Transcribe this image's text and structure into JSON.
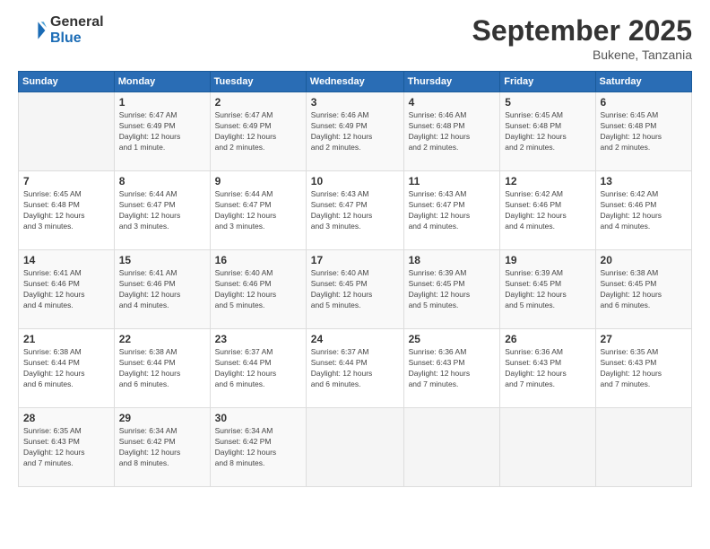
{
  "header": {
    "logo_general": "General",
    "logo_blue": "Blue",
    "title": "September 2025",
    "location": "Bukene, Tanzania"
  },
  "days_of_week": [
    "Sunday",
    "Monday",
    "Tuesday",
    "Wednesday",
    "Thursday",
    "Friday",
    "Saturday"
  ],
  "weeks": [
    [
      {
        "day": "",
        "info": ""
      },
      {
        "day": "1",
        "info": "Sunrise: 6:47 AM\nSunset: 6:49 PM\nDaylight: 12 hours\nand 1 minute."
      },
      {
        "day": "2",
        "info": "Sunrise: 6:47 AM\nSunset: 6:49 PM\nDaylight: 12 hours\nand 2 minutes."
      },
      {
        "day": "3",
        "info": "Sunrise: 6:46 AM\nSunset: 6:49 PM\nDaylight: 12 hours\nand 2 minutes."
      },
      {
        "day": "4",
        "info": "Sunrise: 6:46 AM\nSunset: 6:48 PM\nDaylight: 12 hours\nand 2 minutes."
      },
      {
        "day": "5",
        "info": "Sunrise: 6:45 AM\nSunset: 6:48 PM\nDaylight: 12 hours\nand 2 minutes."
      },
      {
        "day": "6",
        "info": "Sunrise: 6:45 AM\nSunset: 6:48 PM\nDaylight: 12 hours\nand 2 minutes."
      }
    ],
    [
      {
        "day": "7",
        "info": "Sunrise: 6:45 AM\nSunset: 6:48 PM\nDaylight: 12 hours\nand 3 minutes."
      },
      {
        "day": "8",
        "info": "Sunrise: 6:44 AM\nSunset: 6:47 PM\nDaylight: 12 hours\nand 3 minutes."
      },
      {
        "day": "9",
        "info": "Sunrise: 6:44 AM\nSunset: 6:47 PM\nDaylight: 12 hours\nand 3 minutes."
      },
      {
        "day": "10",
        "info": "Sunrise: 6:43 AM\nSunset: 6:47 PM\nDaylight: 12 hours\nand 3 minutes."
      },
      {
        "day": "11",
        "info": "Sunrise: 6:43 AM\nSunset: 6:47 PM\nDaylight: 12 hours\nand 4 minutes."
      },
      {
        "day": "12",
        "info": "Sunrise: 6:42 AM\nSunset: 6:46 PM\nDaylight: 12 hours\nand 4 minutes."
      },
      {
        "day": "13",
        "info": "Sunrise: 6:42 AM\nSunset: 6:46 PM\nDaylight: 12 hours\nand 4 minutes."
      }
    ],
    [
      {
        "day": "14",
        "info": "Sunrise: 6:41 AM\nSunset: 6:46 PM\nDaylight: 12 hours\nand 4 minutes."
      },
      {
        "day": "15",
        "info": "Sunrise: 6:41 AM\nSunset: 6:46 PM\nDaylight: 12 hours\nand 4 minutes."
      },
      {
        "day": "16",
        "info": "Sunrise: 6:40 AM\nSunset: 6:46 PM\nDaylight: 12 hours\nand 5 minutes."
      },
      {
        "day": "17",
        "info": "Sunrise: 6:40 AM\nSunset: 6:45 PM\nDaylight: 12 hours\nand 5 minutes."
      },
      {
        "day": "18",
        "info": "Sunrise: 6:39 AM\nSunset: 6:45 PM\nDaylight: 12 hours\nand 5 minutes."
      },
      {
        "day": "19",
        "info": "Sunrise: 6:39 AM\nSunset: 6:45 PM\nDaylight: 12 hours\nand 5 minutes."
      },
      {
        "day": "20",
        "info": "Sunrise: 6:38 AM\nSunset: 6:45 PM\nDaylight: 12 hours\nand 6 minutes."
      }
    ],
    [
      {
        "day": "21",
        "info": "Sunrise: 6:38 AM\nSunset: 6:44 PM\nDaylight: 12 hours\nand 6 minutes."
      },
      {
        "day": "22",
        "info": "Sunrise: 6:38 AM\nSunset: 6:44 PM\nDaylight: 12 hours\nand 6 minutes."
      },
      {
        "day": "23",
        "info": "Sunrise: 6:37 AM\nSunset: 6:44 PM\nDaylight: 12 hours\nand 6 minutes."
      },
      {
        "day": "24",
        "info": "Sunrise: 6:37 AM\nSunset: 6:44 PM\nDaylight: 12 hours\nand 6 minutes."
      },
      {
        "day": "25",
        "info": "Sunrise: 6:36 AM\nSunset: 6:43 PM\nDaylight: 12 hours\nand 7 minutes."
      },
      {
        "day": "26",
        "info": "Sunrise: 6:36 AM\nSunset: 6:43 PM\nDaylight: 12 hours\nand 7 minutes."
      },
      {
        "day": "27",
        "info": "Sunrise: 6:35 AM\nSunset: 6:43 PM\nDaylight: 12 hours\nand 7 minutes."
      }
    ],
    [
      {
        "day": "28",
        "info": "Sunrise: 6:35 AM\nSunset: 6:43 PM\nDaylight: 12 hours\nand 7 minutes."
      },
      {
        "day": "29",
        "info": "Sunrise: 6:34 AM\nSunset: 6:42 PM\nDaylight: 12 hours\nand 8 minutes."
      },
      {
        "day": "30",
        "info": "Sunrise: 6:34 AM\nSunset: 6:42 PM\nDaylight: 12 hours\nand 8 minutes."
      },
      {
        "day": "",
        "info": ""
      },
      {
        "day": "",
        "info": ""
      },
      {
        "day": "",
        "info": ""
      },
      {
        "day": "",
        "info": ""
      }
    ]
  ]
}
